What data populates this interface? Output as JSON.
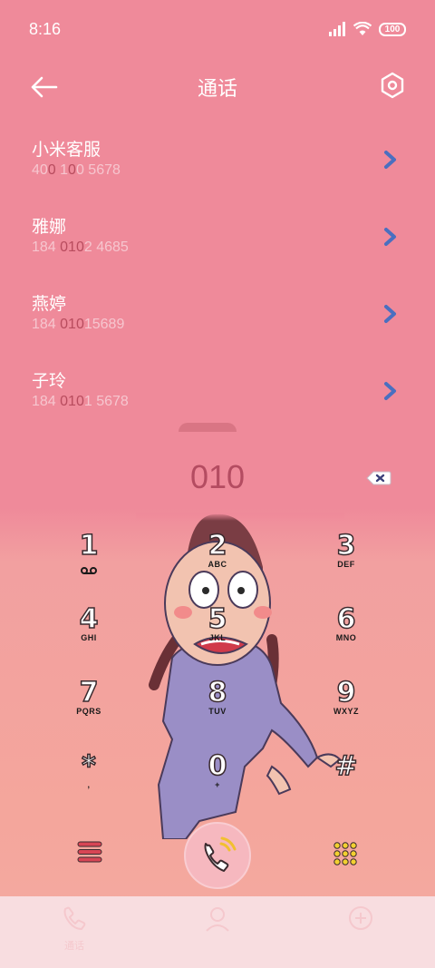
{
  "status_bar": {
    "time": "8:16",
    "battery": "100"
  },
  "header": {
    "title": "通话",
    "back_icon": "arrow-left-icon",
    "settings_icon": "hexagon-gear-icon"
  },
  "contacts": [
    {
      "name": "小米客服",
      "number_pre": "40",
      "number_hl1": "0",
      "number_mid": " 1",
      "number_hl2": "0",
      "number_post": "0 5678"
    },
    {
      "name": "雅娜",
      "number_pre": "184 ",
      "number_hl1": "010",
      "number_mid": "2 4685",
      "number_hl2": "",
      "number_post": ""
    },
    {
      "name": "燕婷",
      "number_pre": "184 ",
      "number_hl1": "010",
      "number_mid": "15689",
      "number_hl2": "",
      "number_post": ""
    },
    {
      "name": "子玲",
      "number_pre": "184 ",
      "number_hl1": "010",
      "number_mid": "1 5678",
      "number_hl2": "",
      "number_post": ""
    }
  ],
  "dialer": {
    "input_value": "010"
  },
  "keypad": [
    {
      "digit": "1",
      "letters": "",
      "icon": "voicemail-icon"
    },
    {
      "digit": "2",
      "letters": "ABC"
    },
    {
      "digit": "3",
      "letters": "DEF"
    },
    {
      "digit": "4",
      "letters": "GHI"
    },
    {
      "digit": "5",
      "letters": "JKL"
    },
    {
      "digit": "6",
      "letters": "MNO"
    },
    {
      "digit": "7",
      "letters": "PQRS"
    },
    {
      "digit": "8",
      "letters": "TUV"
    },
    {
      "digit": "9",
      "letters": "WXYZ"
    },
    {
      "digit": "*",
      "letters": ","
    },
    {
      "digit": "0",
      "letters": "+"
    },
    {
      "digit": "#",
      "letters": ""
    }
  ],
  "bottom_nav": [
    {
      "label": "通话",
      "icon": "phone-icon"
    },
    {
      "label": "",
      "icon": "contacts-icon"
    },
    {
      "label": "",
      "icon": "yellow-pages-icon"
    }
  ],
  "colors": {
    "accent": "#b44c61",
    "arrow": "#4a6fc0",
    "background": "#ef8a9a"
  }
}
